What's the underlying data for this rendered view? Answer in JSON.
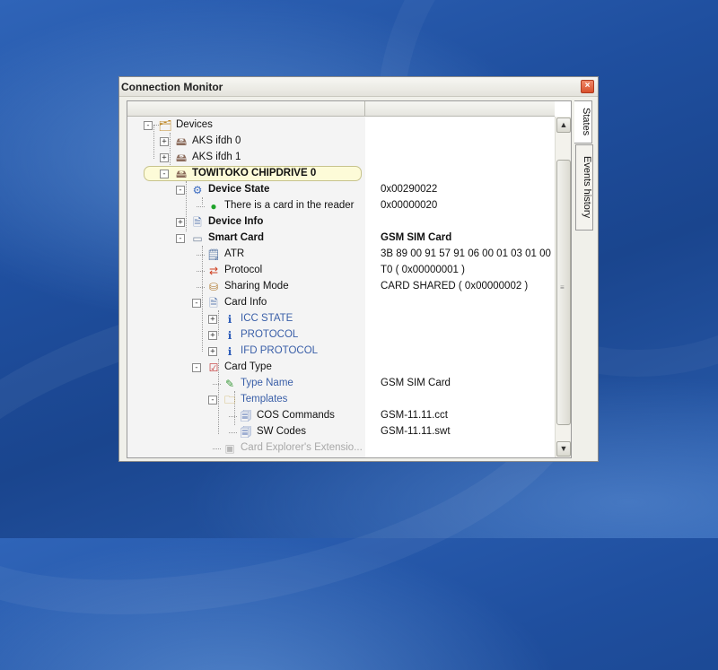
{
  "window": {
    "title": "Connection Monitor",
    "close_glyph": "×"
  },
  "tabs": [
    {
      "label": "States",
      "active": true
    },
    {
      "label": "Events history",
      "active": false
    }
  ],
  "tree": [
    {
      "label": "Devices",
      "value": "",
      "icon": "devices-folder-icon",
      "glyph": "🗂"
    },
    {
      "label": "AKS ifdh 0",
      "value": "",
      "icon": "card-reader-icon",
      "glyph": "🖴"
    },
    {
      "label": "AKS ifdh 1",
      "value": "",
      "icon": "card-reader-icon",
      "glyph": "🖴"
    },
    {
      "label": "TOWITOKO CHIPDRIVE 0",
      "value": "",
      "icon": "card-reader-icon",
      "glyph": "🖴"
    },
    {
      "label": "Device State",
      "value": "0x00290022",
      "icon": "device-state-icon",
      "glyph": "⚙"
    },
    {
      "label": "There is a card in the reader",
      "value": "0x00000020",
      "icon": "green-status-dot-icon",
      "glyph": "●"
    },
    {
      "label": "Device Info",
      "value": "",
      "icon": "info-document-icon",
      "glyph": "🗎"
    },
    {
      "label": "Smart Card",
      "value": "GSM SIM Card",
      "icon": "smart-card-icon",
      "glyph": "▭"
    },
    {
      "label": "ATR",
      "value": "3B 89 00 91 57 91 06 00 01 03 01 00",
      "icon": "atr-icon",
      "glyph": "🗒"
    },
    {
      "label": "Protocol",
      "value": "T0  ( 0x00000001 )",
      "icon": "protocol-arrows-icon",
      "glyph": "⇄"
    },
    {
      "label": "Sharing Mode",
      "value": "CARD SHARED   ( 0x00000002 )",
      "icon": "sharing-mode-icon",
      "glyph": "⛁"
    },
    {
      "label": "Card Info",
      "value": "",
      "icon": "info-document-icon",
      "glyph": "🗎"
    },
    {
      "label": "ICC STATE",
      "value": "",
      "icon": "info-icon",
      "glyph": "ℹ"
    },
    {
      "label": "PROTOCOL",
      "value": "",
      "icon": "info-icon",
      "glyph": "ℹ"
    },
    {
      "label": "IFD PROTOCOL",
      "value": "",
      "icon": "info-icon",
      "glyph": "ℹ"
    },
    {
      "label": "Card Type",
      "value": "",
      "icon": "card-type-checklist-icon",
      "glyph": "☑"
    },
    {
      "label": "Type Name",
      "value": "GSM SIM Card",
      "icon": "type-name-icon",
      "glyph": "✎"
    },
    {
      "label": "Templates",
      "value": "",
      "icon": "templates-folder-icon",
      "glyph": "🗀"
    },
    {
      "label": "COS Commands",
      "value": "GSM-11.11.cct",
      "icon": "template-file-icon",
      "glyph": "🗐"
    },
    {
      "label": "SW Codes",
      "value": "GSM-11.11.swt",
      "icon": "template-file-icon",
      "glyph": "🗐"
    },
    {
      "label": "Card Explorer's Extensio...",
      "value": "",
      "icon": "extension-icon",
      "glyph": "▣"
    }
  ],
  "colors": {
    "status_green": "#1fa32a",
    "link_blue": "#3a5fa8"
  }
}
